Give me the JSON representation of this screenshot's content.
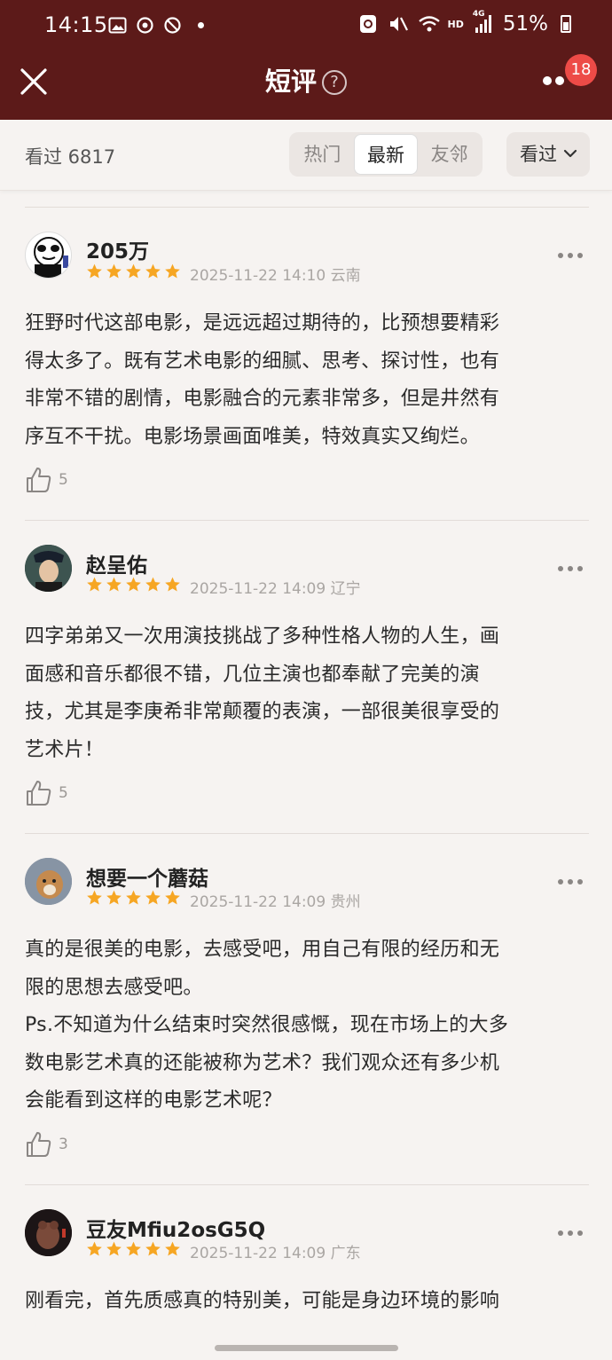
{
  "status_bar": {
    "time": "14:15",
    "icons_left": [
      "image-icon",
      "sync-icon",
      "block-icon"
    ],
    "icons_right": [
      "recycle-icon",
      "mute-icon",
      "wifi-icon",
      "signal-icon"
    ],
    "network_label": "HD",
    "generation_label": "4G",
    "battery": "51%"
  },
  "nav": {
    "title": "短评",
    "help_glyph": "?",
    "badge_count": "18"
  },
  "filter": {
    "watched_label": "看过 6817",
    "tabs": [
      {
        "label": "热门",
        "active": false
      },
      {
        "label": "最新",
        "active": true
      },
      {
        "label": "友邻",
        "active": false
      }
    ],
    "dropdown_label": "看过"
  },
  "colors": {
    "header_bg": "#5c1a19",
    "star": "#f6a623",
    "badge": "#ed4b47",
    "page_bg": "#f6f3f1"
  },
  "reviews": [
    {
      "username": "205万",
      "rating": 5,
      "datetime": "2025-11-22 14:10",
      "location": "云南",
      "lines": [
        "狂野时代这部电影，是远远超过期待的，比预想要精彩",
        "得太多了。既有艺术电影的细腻、思考、探讨性，也有",
        "非常不错的剧情，电影融合的元素非常多，但是井然有",
        "序互不干扰。电影场景画面唯美，特效真实又绚烂。"
      ],
      "likes": "5"
    },
    {
      "username": "赵呈佑",
      "rating": 5,
      "datetime": "2025-11-22 14:09",
      "location": "辽宁",
      "lines": [
        "四字弟弟又一次用演技挑战了多种性格人物的人生，画",
        "面感和音乐都很不错，几位主演也都奉献了完美的演",
        "技，尤其是李庚希非常颠覆的表演，一部很美很享受的",
        "艺术片！"
      ],
      "likes": "5"
    },
    {
      "username": "想要一个蘑菇",
      "rating": 5,
      "datetime": "2025-11-22 14:09",
      "location": "贵州",
      "lines": [
        "真的是很美的电影，去感受吧，用自己有限的经历和无",
        "限的思想去感受吧。",
        "Ps.不知道为什么结束时突然很感慨，现在市场上的大多",
        "数电影艺术真的还能被称为艺术？我们观众还有多少机",
        "会能看到这样的电影艺术呢？"
      ],
      "likes": "3"
    },
    {
      "username": "豆友Mfiu2osG5Q",
      "rating": 5,
      "datetime": "2025-11-22 14:09",
      "location": "广东",
      "lines": [
        "刚看完，首先质感真的特别美，可能是身边环境的影响"
      ],
      "likes": ""
    }
  ]
}
